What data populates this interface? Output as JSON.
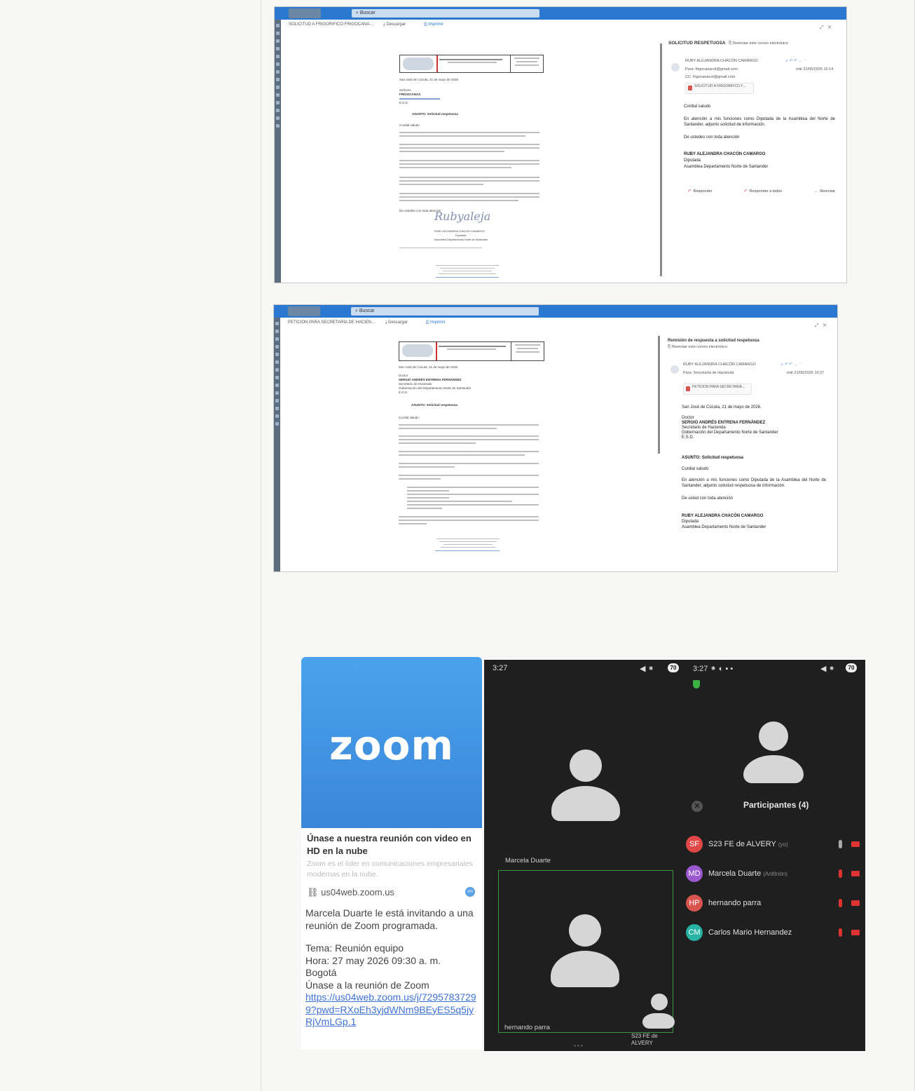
{
  "email1": {
    "search": "Buscar",
    "subject_tab": "SOLICITUD A FRIGORIFICO FRIGOCANA…",
    "download": "Descargar",
    "print": "Imprimir",
    "pane_subject": "SOLICITUD RESPETUOSA",
    "pane_action": "Reenviar este correo electrónico",
    "sender": "RUBY ALEJANDRA CHACÓN CAMARGO",
    "to": "Para: frigocanacol@gmail.com",
    "cc": "CC: frigocanacol@gmail.com",
    "date": "mié 21/05/2026 10:14",
    "attachment": "SOLICITUD A FRIGORIFICO F…",
    "greeting": "Cordial saludo",
    "body": "En atención a mis funciones como Diputada de la Asamblea del Norte de Santander, adjunto solicitud de información.",
    "closing": "De ustedes con toda atención",
    "sig_name": "RUBY ALEJANDRA CHACÓN CAMARGO",
    "sig_role": "Diputada",
    "sig_org": "Asamblea Departamento Norte de Santander",
    "btn_reply": "Responder",
    "btn_reply_all": "Responder a todos",
    "btn_forward": "Reenviar",
    "doc": {
      "city_date": "San José de Cúcuta, 21 de mayo de 2026",
      "addressee": "Señores",
      "company": "FRIGOCANAS",
      "city": "E.S.D.",
      "asunto": "ASUNTO: Solicitud respetuosa",
      "saludo": "Cordial saludo",
      "despedida": "De ustedes con toda atención",
      "firma": "RUBY ALEJANDRA CHACÓN CAMARGO",
      "cargo": "Diputada",
      "org": "Asamblea Departamento Norte de Santander"
    }
  },
  "email2": {
    "search": "Buscar",
    "subject_tab": "PETICION PARA SECRETARIA DE HACIEN…",
    "download": "Descargar",
    "print": "Imprimir",
    "pane_subject": "Remisión de respuesta a solicitud respetuosa",
    "pane_action": "Reenviar este correo electrónico",
    "sender": "RUBY ALEJANDRA CHACÓN CAMARGO",
    "to": "Para: Secretaría de Hacienda",
    "date": "mié 21/05/2026 10:27",
    "attachment": "PETICION PARA SECRETARIA…",
    "city_date": "San José de Cúcuta, 21 de mayo de 2026.",
    "doctor": "Doctor",
    "recipient": "SERGIO ANDRÉS ENTRENA FERNÁNDEZ",
    "recipient_role": "Secretario de Hacienda",
    "recipient_org": "Gobernación del Departamento Norte de Santander",
    "esd": "E.S.D.",
    "asunto": "ASUNTO: Solicitud respetuosa",
    "greeting": "Cordial saludo",
    "body": "En atención a mis funciones como Diputada de la Asamblea del Norte de Santander, adjunto solicitud respetuosa de información.",
    "closing": "De usted con toda atención",
    "sig_name": "RUBY ALEJANDRA CHACÓN CAMARGO",
    "sig_role": "Diputada",
    "sig_org": "Asamblea Departamento Norte de Santander",
    "doc": {
      "city_date": "San José de Cúcuta, 21 de mayo de 2026.",
      "doctor": "Doctor",
      "recipient": "SERGIO ANDRÉS ENTRENA FERNÁNDEZ",
      "role": "Secretario de Hacienda",
      "org": "Gobernación del Departamento Norte de Santander",
      "esd": "E.S.D.",
      "asunto": "ASUNTO: Solicitud respetuosa",
      "saludo": "Cordial saludo"
    }
  },
  "zoom_card": {
    "logo": "zoom",
    "title": "Únase a nuestra reunión con video en HD en la nube",
    "subtitle": "Zoom es el líder en comunicaciones empresariales modernas en la nube.",
    "link": "us04web.zoom.us",
    "badge": "zm",
    "invite": "Marcela Duarte le está invitando a una reunión de Zoom programada.",
    "topic": "Tema: Reunión equipo",
    "time": "Hora: 27 may 2026 09:30 a. m.",
    "tz": "Bogotá",
    "join": "Únase a la reunión de Zoom",
    "url": "https://us04web.zoom.us/j/72957837299?pwd=RXoEh3yjdWNm9BEyES5q5jyRjVmLGp.1"
  },
  "phone1": {
    "time": "3:27",
    "battery": "70",
    "tile1_label": "Marcela Duarte",
    "tile2_label": "hernando parra",
    "tile3_label": "S23 FE de ALVERY"
  },
  "phone2": {
    "time": "3:27",
    "battery": "70",
    "title": "Participantes (4)",
    "participants": [
      {
        "initials": "SF",
        "name": "S23 FE de ALVERY",
        "tag": "(yo)",
        "color": "#e04848"
      },
      {
        "initials": "MD",
        "name": "Marcela Duarte",
        "tag": "(Anfitrión)",
        "color": "#9b59d0"
      },
      {
        "initials": "HP",
        "name": "hernando parra",
        "tag": "",
        "color": "#d9534f"
      },
      {
        "initials": "CM",
        "name": "Carlos Mario Hernandez",
        "tag": "",
        "color": "#26b3a4"
      }
    ]
  }
}
